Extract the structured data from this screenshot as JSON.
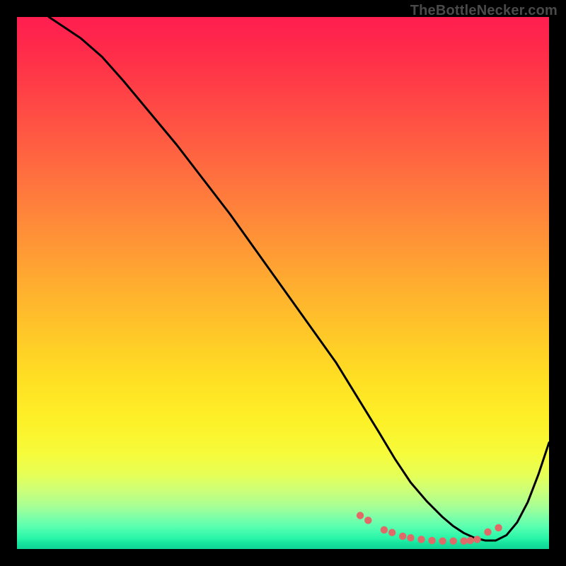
{
  "watermark": "TheBottleNecker.com",
  "colors": {
    "page_bg": "#000000",
    "curve": "#000000",
    "marker": "#e06a68",
    "watermark": "#4a4a4a"
  },
  "chart_data": {
    "type": "line",
    "title": "",
    "xlabel": "",
    "ylabel": "",
    "xlim": [
      0,
      100
    ],
    "ylim": [
      0,
      100
    ],
    "curve": {
      "x": [
        6,
        9,
        12,
        16,
        20,
        25,
        30,
        35,
        40,
        45,
        50,
        55,
        60,
        64,
        68,
        71,
        74,
        77,
        80,
        82,
        84,
        86,
        88,
        90,
        92,
        94,
        96,
        98,
        100
      ],
      "y": [
        100,
        98,
        96,
        92.5,
        88,
        82,
        76,
        69.5,
        63,
        56,
        49,
        42,
        35,
        28.5,
        22,
        17,
        12.5,
        9,
        6,
        4.3,
        3,
        2.1,
        1.6,
        1.6,
        2.6,
        5,
        8.8,
        14,
        20
      ]
    },
    "markers": {
      "x": [
        64.5,
        66,
        69,
        70.5,
        72.5,
        74,
        76,
        78,
        80,
        82,
        84,
        85.2,
        86.5,
        88.5,
        90.5
      ],
      "y": [
        6.3,
        5.4,
        3.6,
        3.1,
        2.4,
        2.1,
        1.8,
        1.6,
        1.5,
        1.5,
        1.5,
        1.6,
        1.8,
        3.2,
        4.0
      ]
    }
  }
}
